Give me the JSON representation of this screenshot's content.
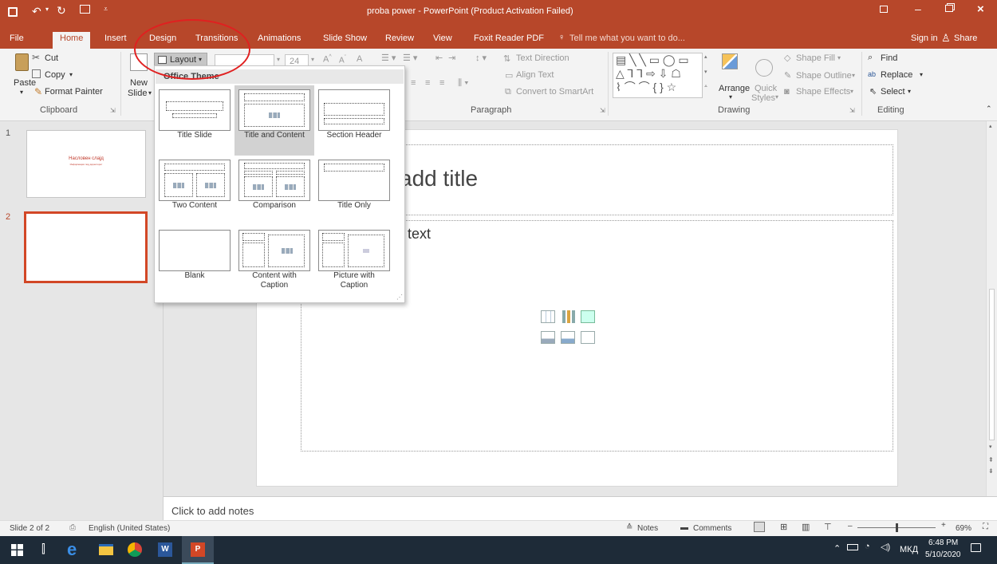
{
  "window": {
    "title": "proba power - PowerPoint (Product Activation Failed)"
  },
  "tabs": [
    "File",
    "Home",
    "Insert",
    "Design",
    "Transitions",
    "Animations",
    "Slide Show",
    "Review",
    "View",
    "Foxit Reader PDF"
  ],
  "tell_me": "Tell me what you want to do...",
  "account": {
    "sign_in": "Sign in",
    "share": "Share"
  },
  "clipboard": {
    "paste": "Paste",
    "cut": "Cut",
    "copy": "Copy",
    "format_painter": "Format Painter",
    "group": "Clipboard"
  },
  "slides_group": {
    "new_slide_1": "New",
    "new_slide_2": "Slide",
    "layout": "Layout"
  },
  "font": {
    "size": "24"
  },
  "paragraph": {
    "text_direction": "Text Direction",
    "align_text": "Align Text",
    "convert": "Convert to SmartArt",
    "group": "Paragraph"
  },
  "drawing": {
    "arrange": "Arrange",
    "quick_styles_1": "Quick",
    "quick_styles_2": "Styles",
    "shape_fill": "Shape Fill",
    "shape_outline": "Shape Outline",
    "shape_effects": "Shape Effects",
    "group": "Drawing"
  },
  "editing": {
    "find": "Find",
    "replace": "Replace",
    "select": "Select",
    "group": "Editing"
  },
  "layout_menu": {
    "heading": "Office Theme",
    "items": [
      "Title Slide",
      "Title and Content",
      "Section Header",
      "Two Content",
      "Comparison",
      "Title Only",
      "Blank",
      "Content with Caption",
      "Picture with Caption"
    ],
    "selected": "Title and Content"
  },
  "thumbnails": [
    {
      "num": "1",
      "title": "Насловен слајд",
      "subtitle": "Информации под директорот"
    },
    {
      "num": "2"
    }
  ],
  "slide": {
    "title_placeholder": "add title",
    "body_placeholder": "text"
  },
  "notes_placeholder": "Click to add notes",
  "status": {
    "slide_info": "Slide 2 of 2",
    "language": "English (United States)",
    "notes": "Notes",
    "comments": "Comments",
    "zoom": "69%"
  },
  "taskbar": {
    "time": "6:48 PM",
    "date": "5/10/2020",
    "lang": "МКД"
  },
  "colors": {
    "accent": "#b7472a",
    "annotation": "#e02020"
  }
}
